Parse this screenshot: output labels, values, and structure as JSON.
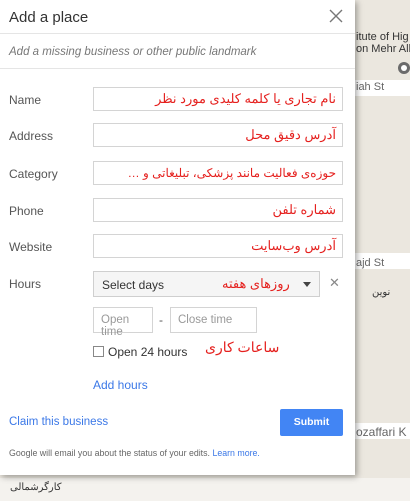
{
  "dialog": {
    "title": "Add a place",
    "subtitle": "Add a missing business or other public landmark"
  },
  "fields": {
    "name": {
      "label": "Name",
      "hint": "نام تجاری یا کلمه کلیدی مورد نظر"
    },
    "address": {
      "label": "Address",
      "hint": "آدرس دقیق محل"
    },
    "category": {
      "label": "Category",
      "hint": "حوزه‌ی فعالیت مانند پزشکی، تبلیغاتی و …"
    },
    "phone": {
      "label": "Phone",
      "hint": "شماره تلفن"
    },
    "website": {
      "label": "Website",
      "hint": "آدرس وب‌سایت"
    }
  },
  "hours": {
    "label": "Hours",
    "select_text": "Select days",
    "select_hint": "روزهای هفته",
    "open_placeholder": "Open time",
    "close_placeholder": "Close time",
    "open24_label": "Open 24 hours",
    "time_hint": "ساعات کاری",
    "add_hours": "Add hours"
  },
  "footer": {
    "claim": "Claim this business",
    "submit": "Submit",
    "note": "Google will email you about the status of your edits.",
    "learn_more": "Learn more."
  },
  "map": {
    "labels": [
      "itute of Hig",
      "on Mehr Alb",
      "iah St",
      "ajd St",
      "نوین",
      "ozaffari K",
      "کارگرشمالی"
    ]
  },
  "colors": {
    "accent": "#4285f4",
    "link": "#3b78e7",
    "hint_red": "#e5201e"
  }
}
